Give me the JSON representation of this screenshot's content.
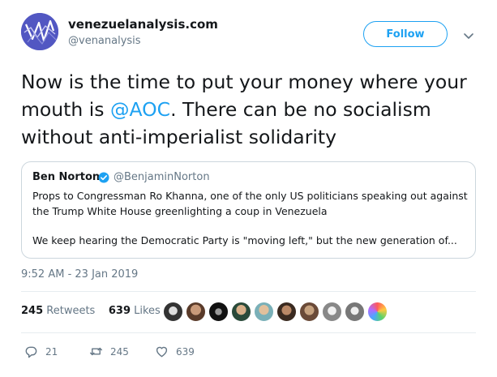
{
  "account": {
    "name": "venezuelanalysis.com",
    "handle": "@venanalysis",
    "follow_label": "Follow"
  },
  "tweet": {
    "text_before": "Now is the time to put your money where your mouth is ",
    "mention": "@AOC",
    "text_after": ". There can be no socialism without anti-imperialist solidarity",
    "timestamp": "9:52 AM - 23 Jan 2019"
  },
  "quoted": {
    "name": "Ben Norton",
    "handle": "@BenjaminNorton",
    "text_1": "Props to Congressman Ro Khanna, one of the only US politicians speaking out against the Trump White House greenlighting a coup in Venezuela",
    "text_2": "We keep hearing the Democratic Party is \"moving left,\" but the new generation of..."
  },
  "stats": {
    "retweets_count": "245",
    "retweets_label": "Retweets",
    "likes_count": "639",
    "likes_label": "Likes"
  },
  "actions": {
    "reply_count": "21",
    "retweet_count": "245",
    "like_count": "639"
  },
  "colors": {
    "accent": "#1da1f2",
    "secondary_text": "#657786",
    "border": "#e6ecf0"
  },
  "icons": [
    "venezuelanalysis-logo",
    "chevron-down-icon",
    "verified-badge-icon",
    "reply-icon",
    "retweet-icon",
    "like-icon"
  ]
}
